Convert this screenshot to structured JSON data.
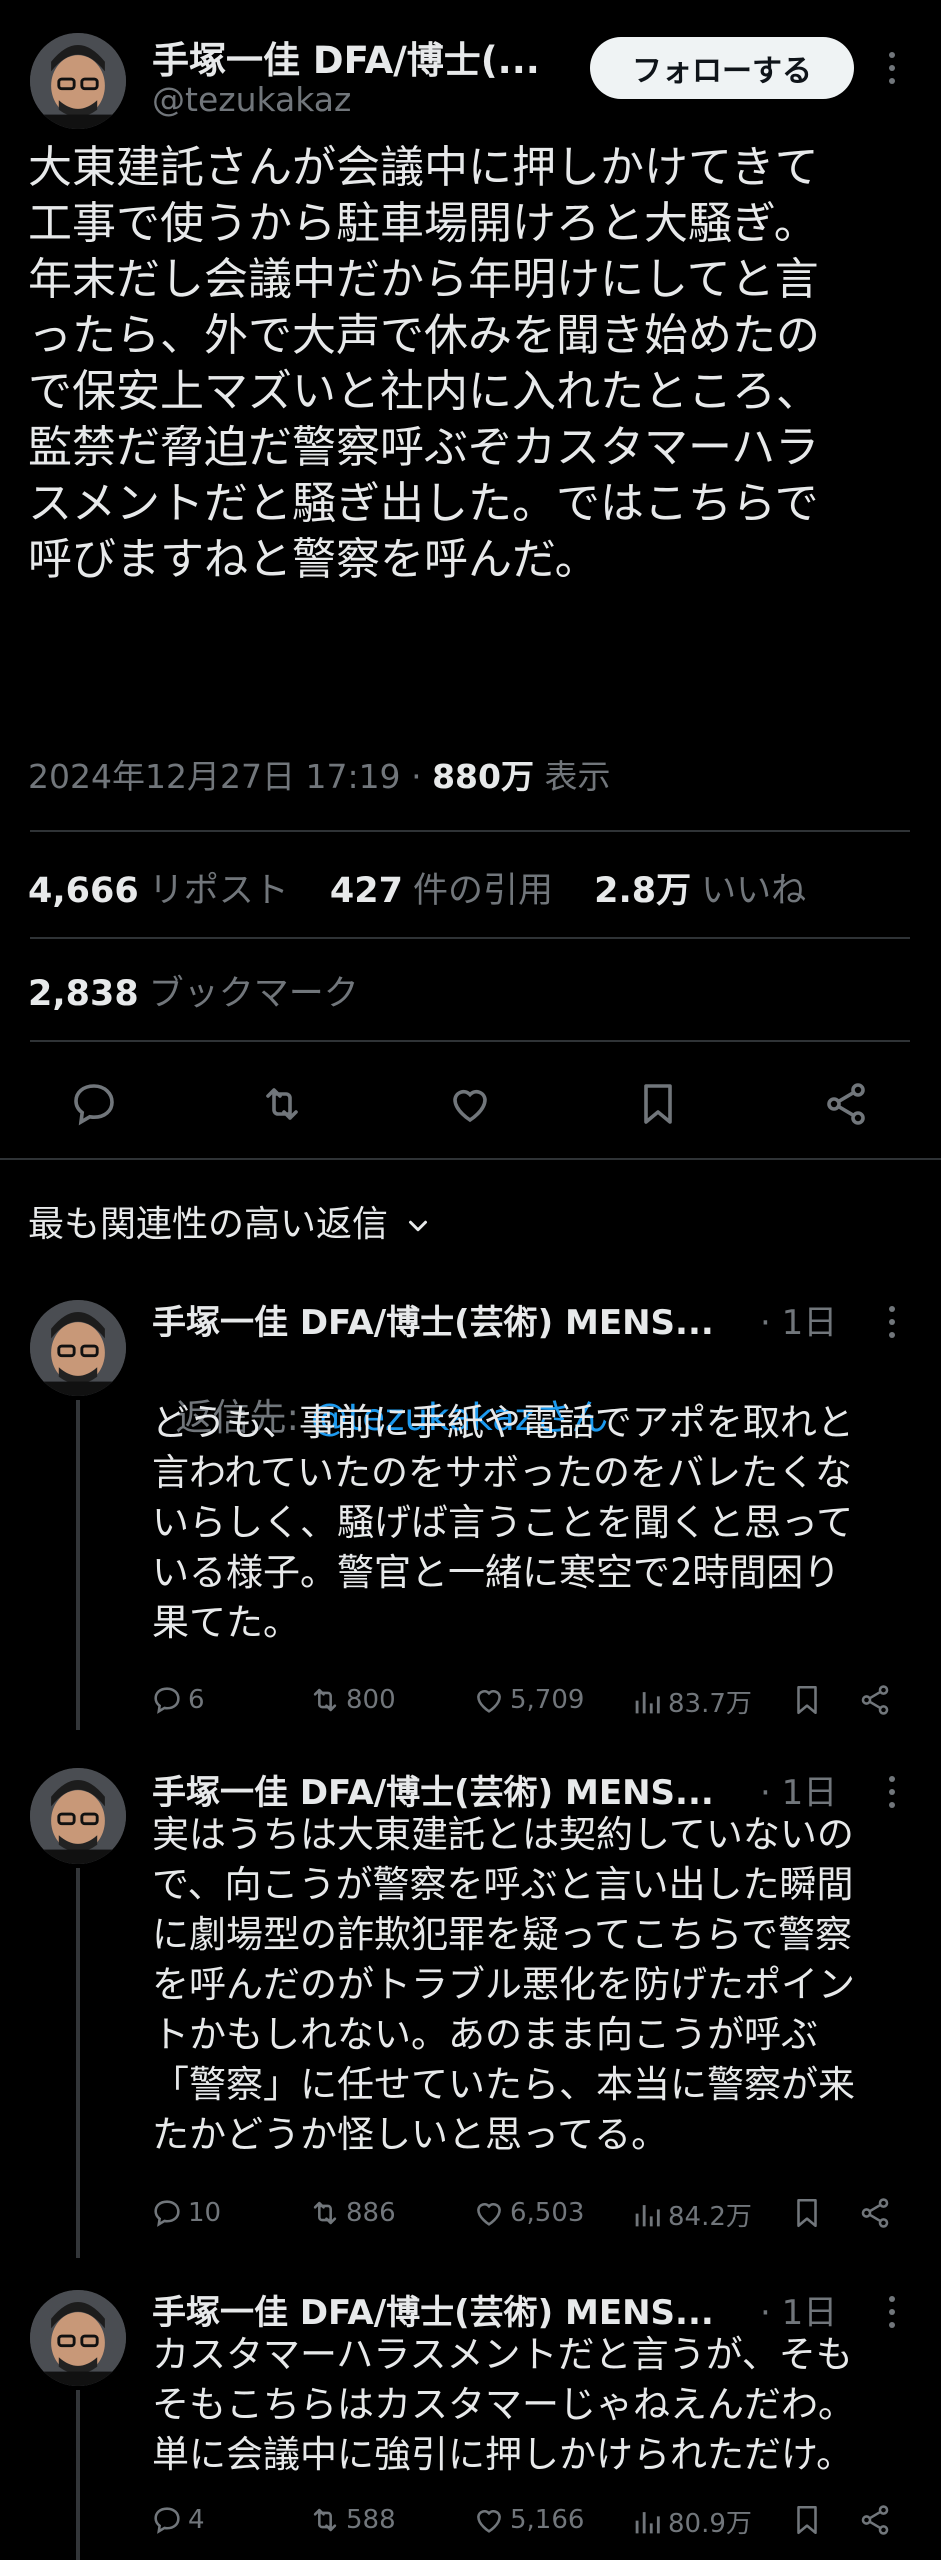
{
  "main": {
    "name": "手塚一佳 DFA/博士(...",
    "handle": "@tezukakaz",
    "follow_label": "フォローする",
    "text": "大東建託さんが会議中に押しかけてきて\n工事で使うから駐車場開けろと大騒ぎ。\n年末だし会議中だから年明けにしてと言\nったら、外で大声で休みを聞き始めたの\nで保安上マズいと社内に入れたところ、\n監禁だ脅迫だ警察呼ぶぞカスタマーハラ\nスメントだと騒ぎ出した。ではこちらで\n呼びますねと警察を呼んだ。",
    "date": "2024年12月27日 17:19",
    "sep": "·",
    "views": "880万",
    "views_label": "表示",
    "reposts": "4,666",
    "reposts_label": "リポスト",
    "quotes": "427",
    "quotes_label": "件の引用",
    "likes": "2.8万",
    "likes_label": "いいね",
    "bookmarks": "2,838",
    "bookmarks_label": "ブックマーク"
  },
  "relevant_label": "最も関連性の高い返信",
  "replies": [
    {
      "name": "手塚一佳 DFA/博士(芸術) MENS...",
      "time": "· 1日",
      "reply_to_label": "返信先: ",
      "reply_to_handle": "@tezukakazさん",
      "text": "どうも、事前に手紙や電話でアポを取れと\n言われていたのをサボったのをバレたくな\nいらしく、騒げば言うことを聞くと思って\nいる様子。警官と一緒に寒空で2時間困り\n果てた。",
      "replies": "6",
      "reposts": "800",
      "likes": "5,709",
      "views": "83.7万"
    },
    {
      "name": "手塚一佳 DFA/博士(芸術) MENS...",
      "time": "· 1日",
      "text": "実はうちは大東建託とは契約していないの\nで、向こうが警察を呼ぶと言い出した瞬間\nに劇場型の詐欺犯罪を疑ってこちらで警察\nを呼んだのがトラブル悪化を防げたポイン\nトかもしれない。あのまま向こうが呼ぶ\n「警察」に任せていたら、本当に警察が来\nたかどうか怪しいと思ってる。",
      "replies": "10",
      "reposts": "886",
      "likes": "6,503",
      "views": "84.2万"
    },
    {
      "name": "手塚一佳 DFA/博士(芸術) MENS...",
      "time": "· 1日",
      "text": "カスタマーハラスメントだと言うが、そも\nそもこちらはカスタマーじゃねえんだわ。\n単に会議中に強引に押しかけられただけ。",
      "replies": "4",
      "reposts": "588",
      "likes": "5,166",
      "views": "80.9万"
    }
  ],
  "colors": {
    "bg": "#000000",
    "text": "#e7e9ea",
    "muted": "#71767b",
    "link": "#1d9bf0",
    "border": "#2f3336"
  }
}
